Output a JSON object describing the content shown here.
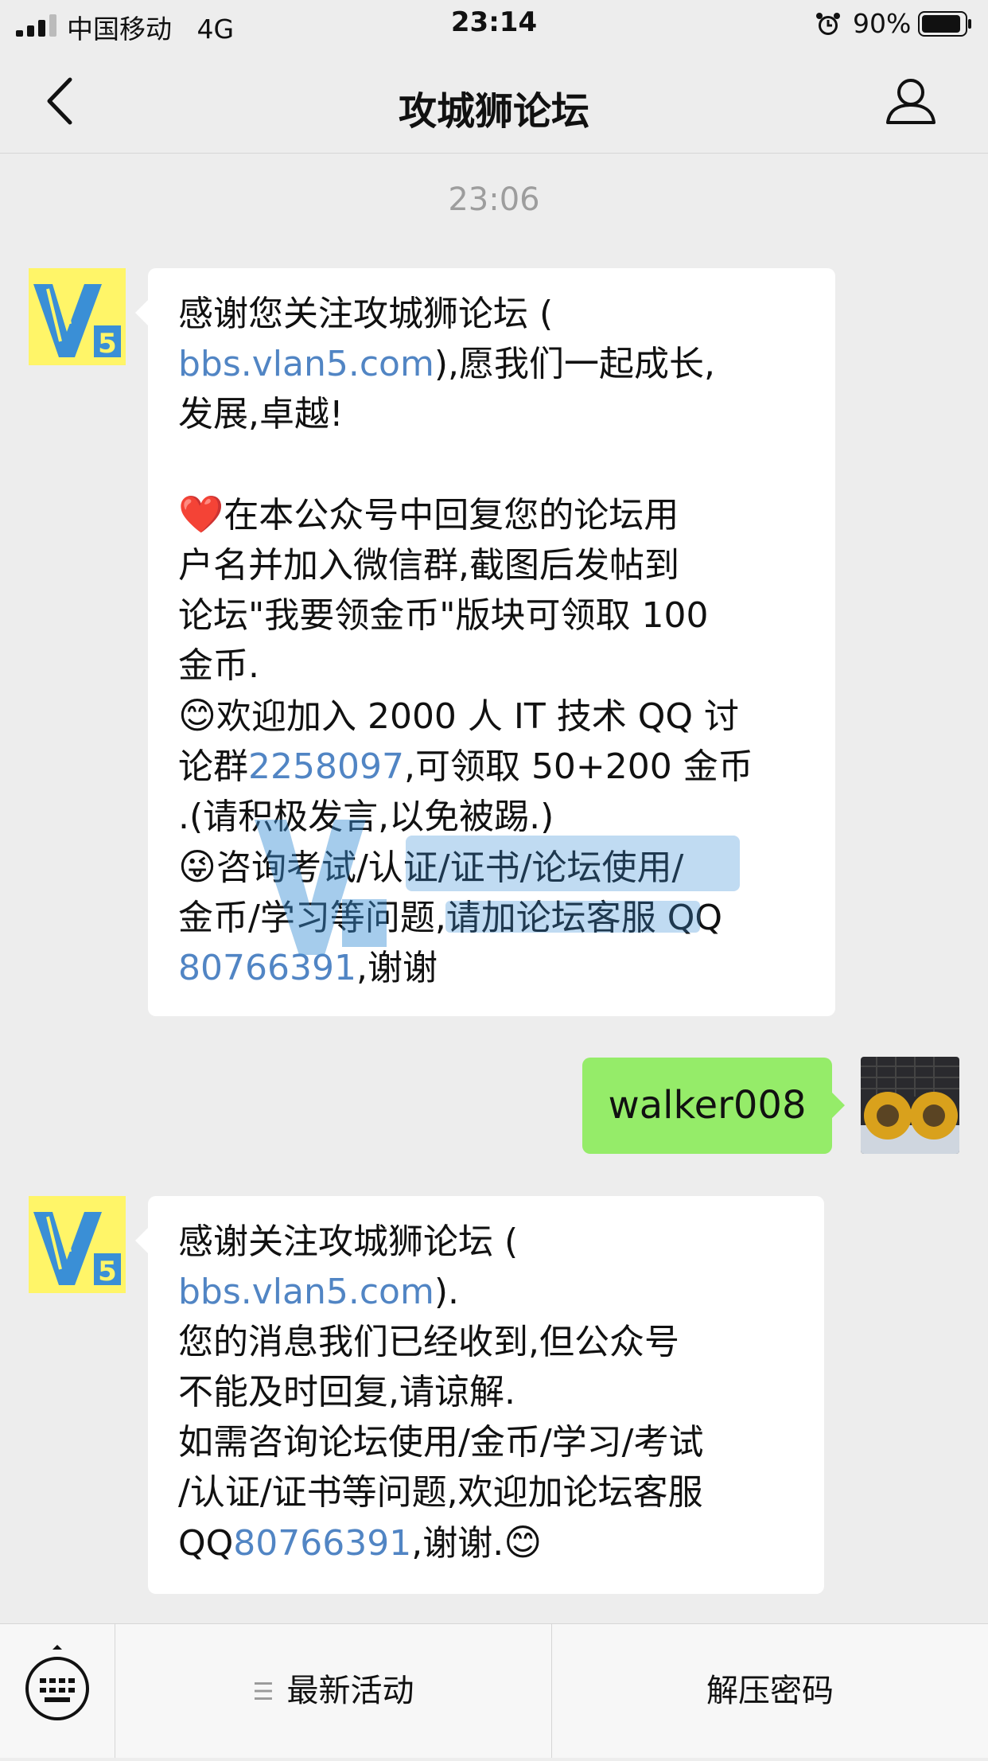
{
  "status_bar": {
    "carrier": "中国移动",
    "network": "4G",
    "time": "23:14",
    "battery_percent": "90%"
  },
  "nav": {
    "title": "攻城狮论坛",
    "back_icon": "chevron-left-icon",
    "profile_icon": "person-icon"
  },
  "timestamp": "23:06",
  "messages": {
    "first": {
      "l1": "感谢您关注攻城狮论坛 (",
      "l2_link": "bbs.vlan5.com",
      "l2_rest": "),愿我们一起成长,",
      "l3": "发展,卓越!",
      "l5_emoji": "❤️",
      "l5": "在本公众号中回复您的论坛用",
      "l6": "户名并加入微信群,截图后发帖到",
      "l7": "论坛\"我要领金币\"版块可领取 100",
      "l8": "金币.",
      "l9_emoji": "😊",
      "l9": "欢迎加入 2000 人 IT 技术 QQ 讨",
      "l10_pre": "论群",
      "l10_link": "2258097",
      "l10_rest": ",可领取 50+200 金币",
      "l11": ".(请积极发言,以免被踢.)",
      "l12_emoji": "😜",
      "l12": "咨询考试/认证/证书/论坛使用/",
      "l13": "金币/学习等问题,请加论坛客服 QQ",
      "l14_link": "80766391",
      "l14_rest": ",谢谢"
    },
    "reply": "walker008",
    "second": {
      "l1": "感谢关注攻城狮论坛 (",
      "l2_link": "bbs.vlan5.com",
      "l2_rest": ").",
      "l3": "您的消息我们已经收到,但公众号",
      "l4": "不能及时回复,请谅解.",
      "l5": "如需咨询论坛使用/金币/学习/考试",
      "l6": "/认证/证书等问题,欢迎加论坛客服",
      "l7_pre": "QQ",
      "l7_link": "80766391",
      "l7_rest": ",谢谢.",
      "l7_emoji": "😊"
    }
  },
  "bottom_menu": {
    "item1": "最新活动",
    "item2": "解压密码"
  },
  "colors": {
    "link": "#5185c4",
    "outgoing_bubble": "#95ec69",
    "avatar_bg": "#fff568"
  }
}
